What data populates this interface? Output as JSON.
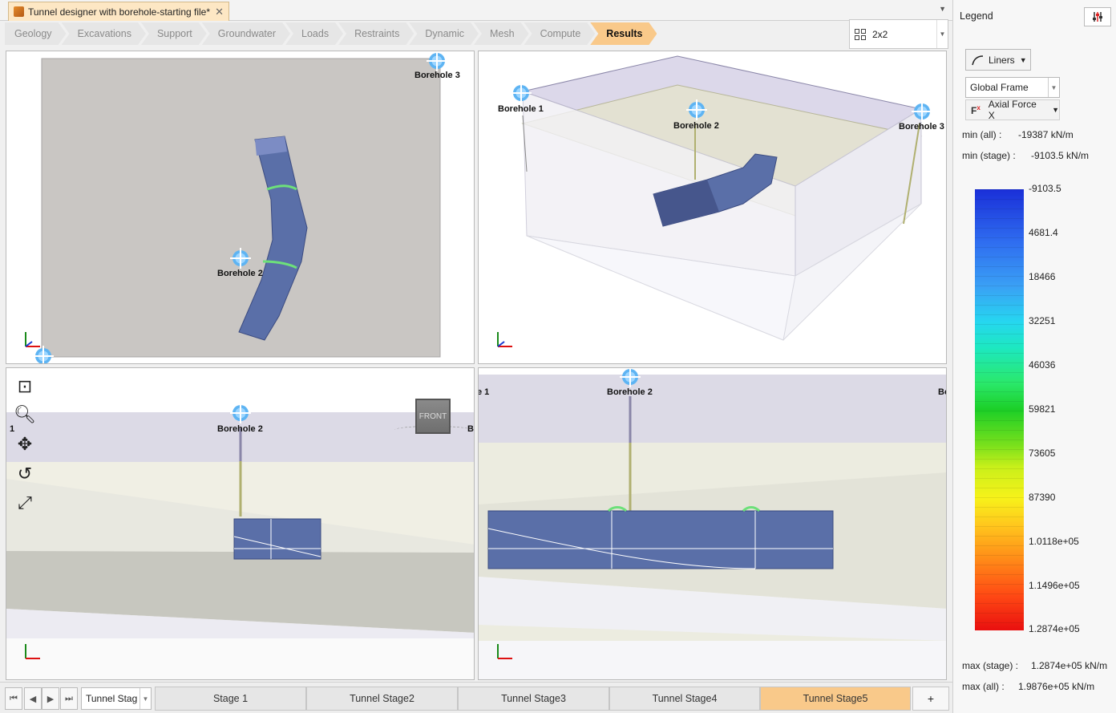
{
  "document_tab": {
    "title": "Tunnel designer with borehole-starting file*",
    "close_glyph": "✕"
  },
  "workflow": {
    "steps": [
      "Geology",
      "Excavations",
      "Support",
      "Groundwater",
      "Loads",
      "Restraints",
      "Dynamic",
      "Mesh",
      "Compute",
      "Results"
    ],
    "active": "Results"
  },
  "layout_select": {
    "value": "2x2"
  },
  "viewports": {
    "top_left": {
      "boreholes": [
        "Borehole 3",
        "Borehole 2"
      ]
    },
    "top_right": {
      "boreholes": [
        "Borehole 1",
        "Borehole 2",
        "Borehole 3"
      ]
    },
    "bottom_left": {
      "boreholes": [
        "1",
        "Borehole 2",
        "B"
      ],
      "view_cube": "FRONT"
    },
    "bottom_right": {
      "boreholes": [
        "e 1",
        "Borehole 2",
        "Bo"
      ]
    }
  },
  "tools": [
    "zoom-window-icon",
    "zoom-icon",
    "pan-icon",
    "rotate-icon",
    "fit-extents-icon"
  ],
  "legend": {
    "title": "Legend",
    "liners_label": "Liners",
    "frame_select": "Global Frame",
    "force_label": "Axial Force X",
    "min_all_label": "min (all) :",
    "min_all_value": "-19387 kN/m",
    "min_stage_label": "min (stage) :",
    "min_stage_value": "-9103.5 kN/m",
    "ticks": [
      "-9103.5",
      "4681.4",
      "18466",
      "32251",
      "46036",
      "59821",
      "73605",
      "87390",
      "1.0118e+05",
      "1.1496e+05",
      "1.2874e+05"
    ],
    "max_stage_label": "max (stage) :",
    "max_stage_value": "1.2874e+05 kN/m",
    "max_all_label": "max (all) :",
    "max_all_value": "1.9876e+05 kN/m",
    "colors": {
      "min": "#1a2fd8",
      "mid": "#1ccf27",
      "max": "#e90f0f"
    }
  },
  "stagebar": {
    "stage_select": "Tunnel Stag",
    "stages": [
      "Stage 1",
      "Tunnel Stage2",
      "Tunnel Stage3",
      "Tunnel Stage4",
      "Tunnel Stage5"
    ],
    "active_stage": "Tunnel Stage5",
    "add_label": "+"
  },
  "colors": {
    "active_step": "#f9c98a",
    "tunnel": "#5a6fa8",
    "soil": "#c9c6c3"
  }
}
